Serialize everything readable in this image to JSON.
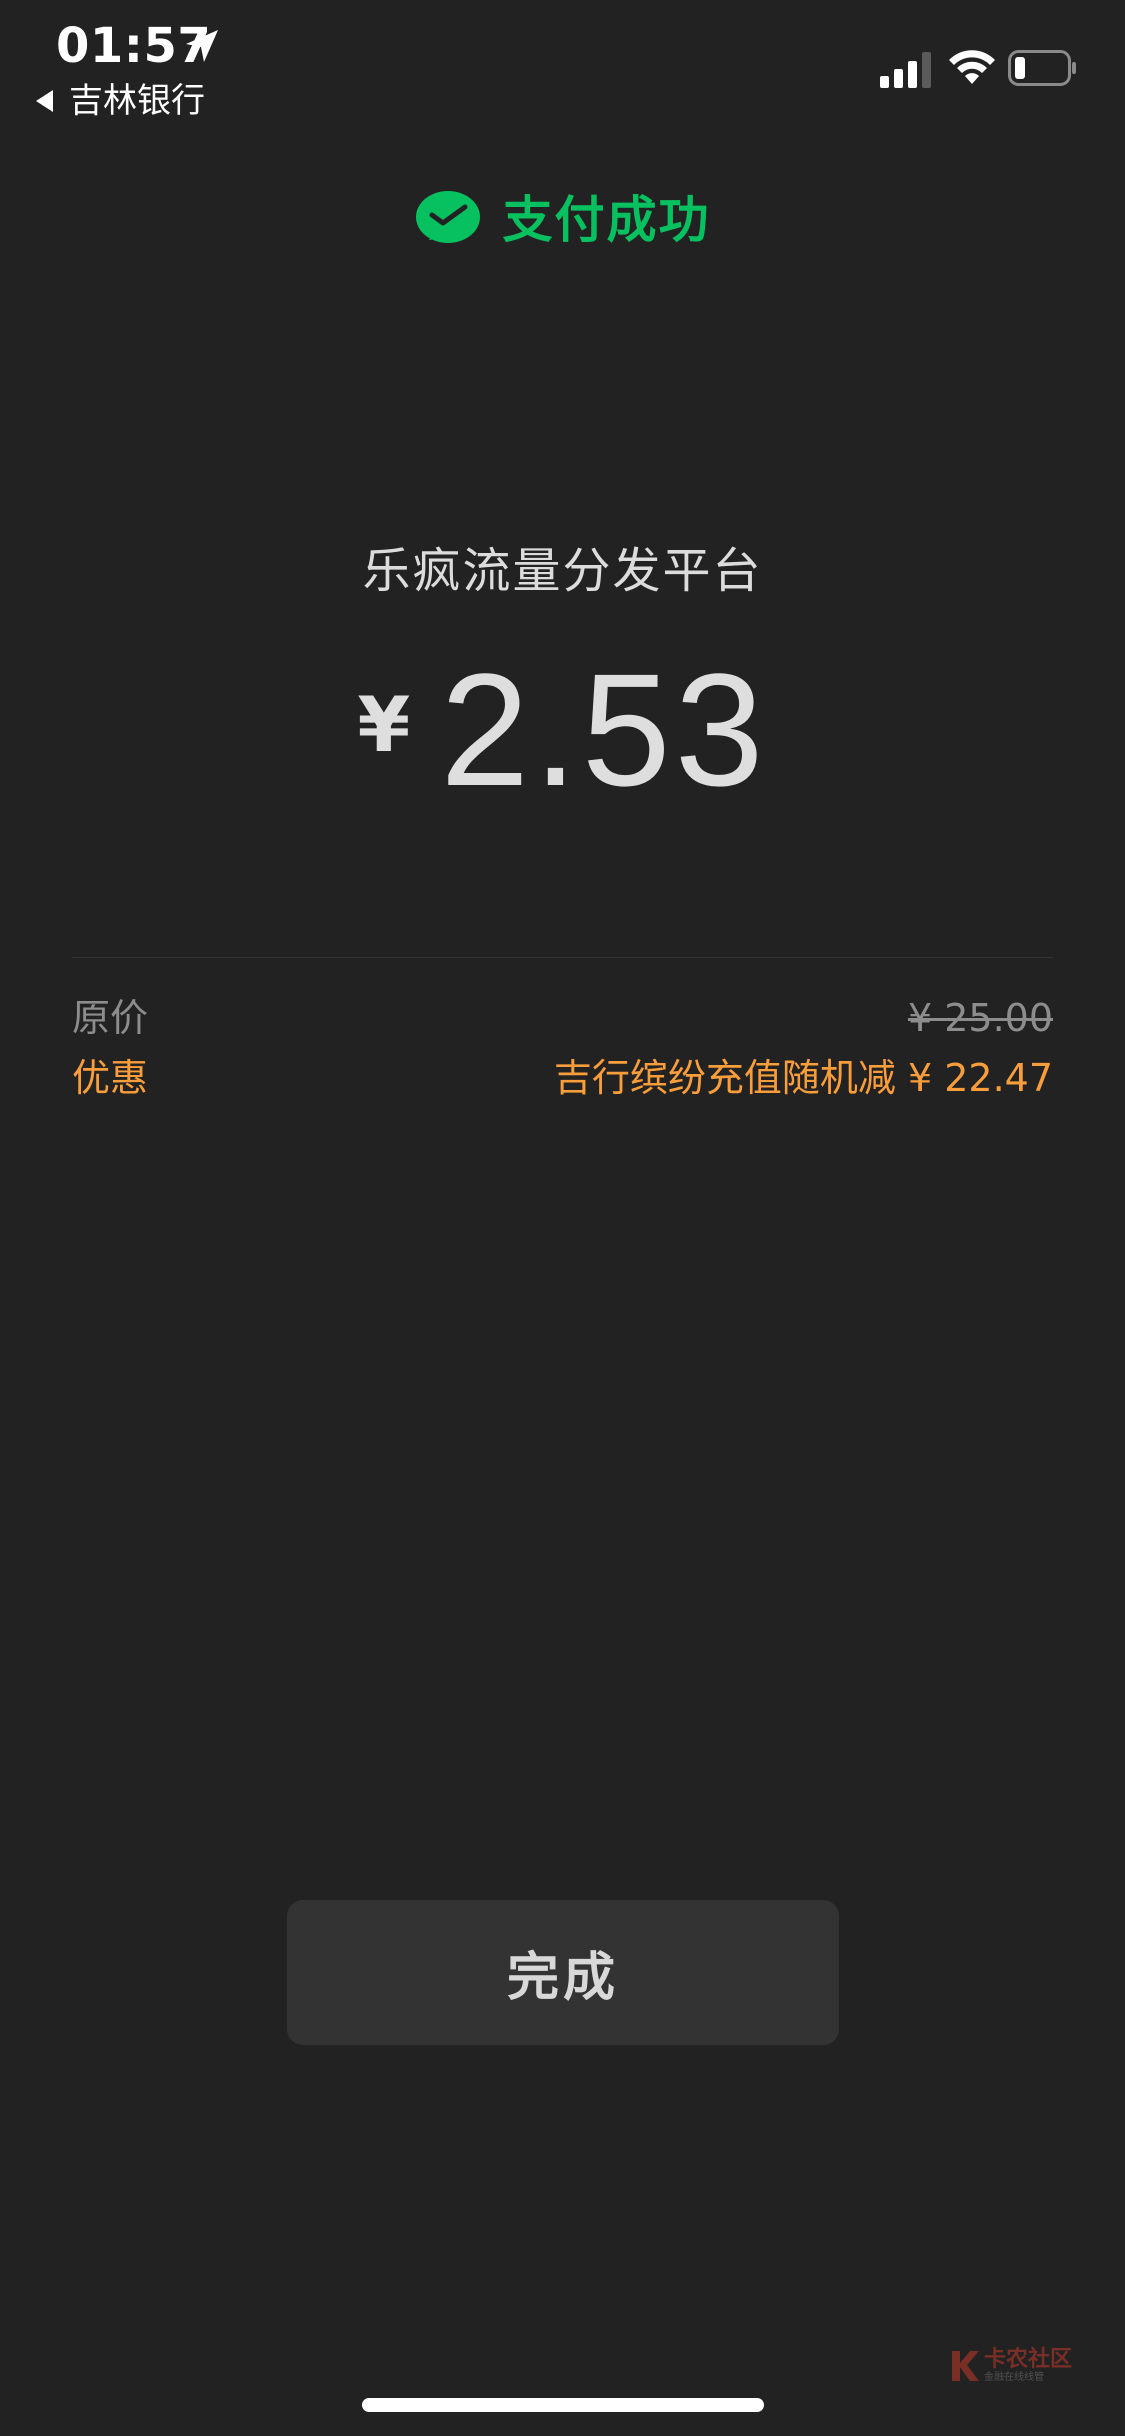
{
  "status_bar": {
    "time": "01:57",
    "back_app": "吉林银行",
    "battery_level": 0.2
  },
  "header": {
    "title": "支付成功",
    "accent_color": "#07c160",
    "icon": "wechat-pay-check-icon"
  },
  "payment": {
    "merchant": "乐疯流量分发平台",
    "currency_symbol": "¥",
    "amount": "2.53"
  },
  "details": {
    "original_label": "原价",
    "original_value": "¥ 25.00",
    "discount_label": "优惠",
    "discount_value": "吉行缤纷充值随机减 ¥ 22.47",
    "discount_color": "#fa9d3b"
  },
  "actions": {
    "done_label": "完成"
  },
  "watermark": {
    "text": "卡农社区",
    "subtext": "金融在线线管"
  }
}
